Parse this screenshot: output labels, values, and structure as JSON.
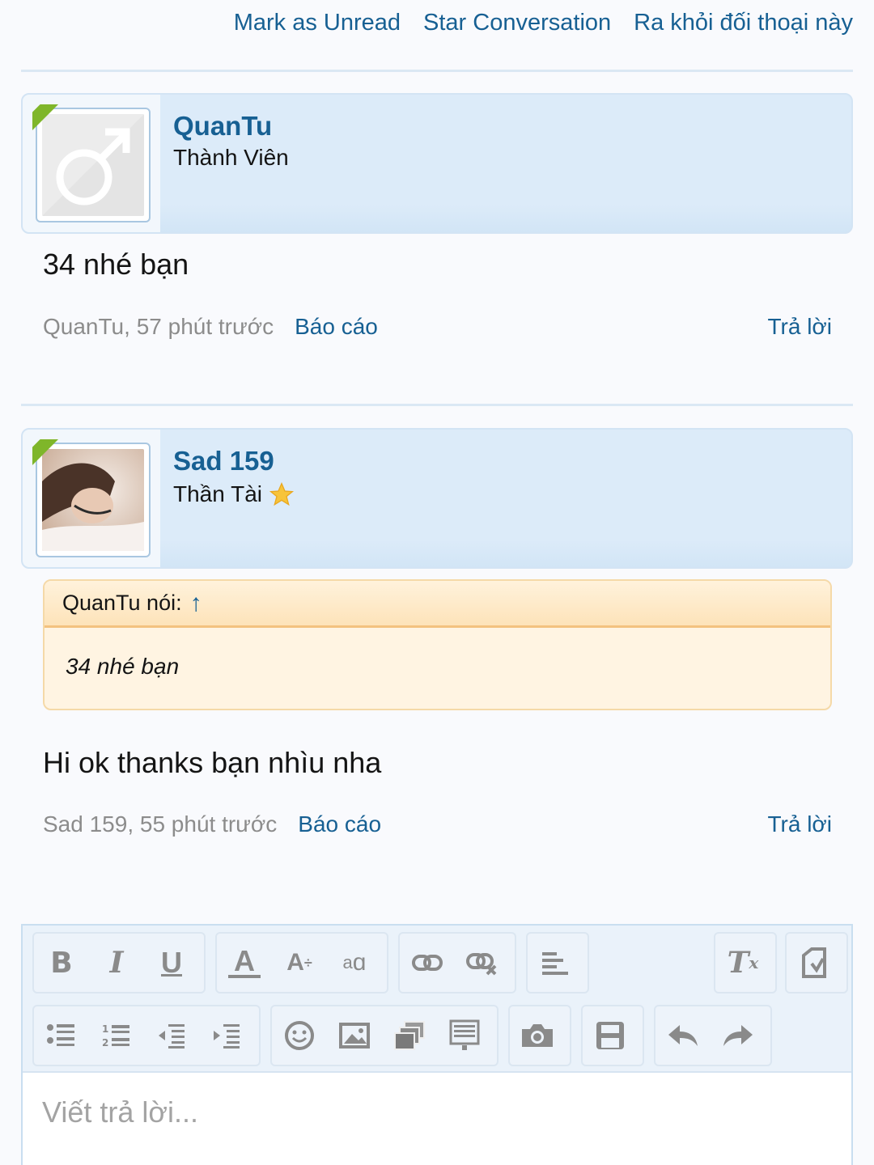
{
  "top_actions": {
    "mark_unread": "Mark as Unread",
    "star": "Star Conversation",
    "leave": "Ra khỏi đối thoại này"
  },
  "messages": [
    {
      "username": "QuanTu",
      "user_title": "Thành Viên",
      "text": "34 nhé bạn",
      "meta": "QuanTu, 57 phút trước",
      "report": "Báo cáo",
      "reply": "Trả lời"
    },
    {
      "username": "Sad 159",
      "user_title": "Thần Tài",
      "quote_header": "QuanTu nói:",
      "quote_arrow": "↑",
      "quote_text": "34 nhé bạn",
      "text": "Hi ok thanks bạn nhìu nha",
      "meta": "Sad 159, 55 phút trước",
      "report": "Báo cáo",
      "reply": "Trả lời"
    }
  ],
  "editor": {
    "placeholder": "Viết trả lời...",
    "toolbar_row1": [
      "bold-icon",
      "italic-icon",
      "underline-icon",
      "font-color-icon",
      "font-size-icon",
      "font-family-icon",
      "link-icon",
      "unlink-icon",
      "align-icon",
      "remove-format-icon",
      "toggle-bbcode-icon"
    ],
    "toolbar_row2": [
      "unordered-list-icon",
      "ordered-list-icon",
      "outdent-icon",
      "indent-icon",
      "smilie-icon",
      "image-icon",
      "media-icon",
      "code-icon",
      "attach-photo-icon",
      "save-draft-icon",
      "undo-icon",
      "redo-icon"
    ]
  }
}
